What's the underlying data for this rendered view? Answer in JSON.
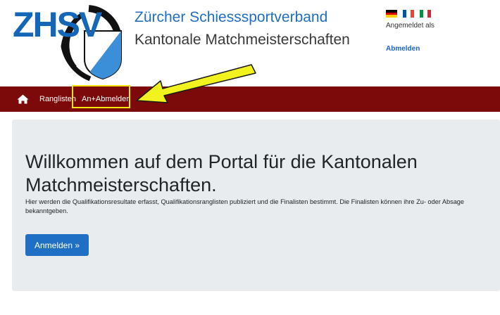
{
  "logo": {
    "text": "ZHSV"
  },
  "header": {
    "org_name": "Zürcher Schiesssportverband",
    "subtitle": "Kantonale Matchmeisterschaften"
  },
  "user": {
    "logged_in_label": "Angemeldet als",
    "logout_label": "Abmelden",
    "languages": [
      "de",
      "fr",
      "it"
    ]
  },
  "nav": {
    "home_icon": "home-icon",
    "items": [
      {
        "label": "Ranglisten"
      },
      {
        "label": "An+Abmelden"
      }
    ]
  },
  "jumbotron": {
    "title": "Willkommen auf dem Portal für die Kantonalen Matchmeisterschaften.",
    "text": "Hier werden die Qualifikationsresultate erfasst, Qualifikationsranglisten publiziert und die Finalisten bestimmt. Die Finalisten können ihre Zu- oder Absage bekanntgeben.",
    "button_label": "Anmelden »"
  },
  "colors": {
    "navbar": "#7d0a0a",
    "brand_blue": "#1f6fc4",
    "highlight": "#f3e70f",
    "jumbotron_bg": "#e9ecef"
  }
}
